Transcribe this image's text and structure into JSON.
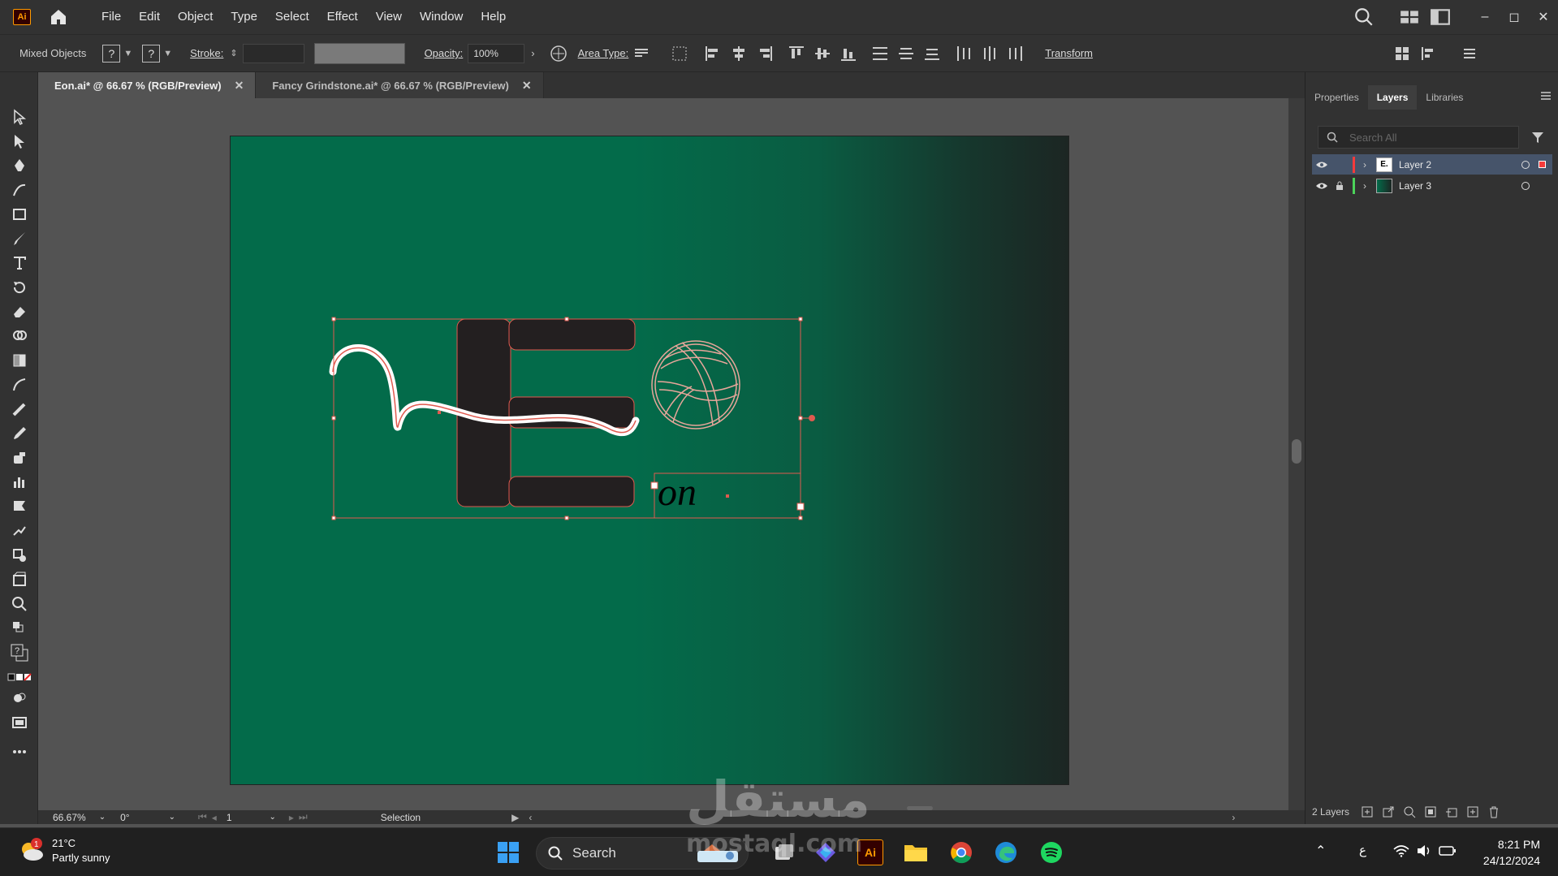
{
  "app": {
    "logo": "Ai"
  },
  "menu": [
    "File",
    "Edit",
    "Object",
    "Type",
    "Select",
    "Effect",
    "View",
    "Window",
    "Help"
  ],
  "window_controls": [
    "–",
    "◻",
    "✕"
  ],
  "controlbar": {
    "selection_label": "Mixed Objects",
    "fill_placeholder": "?",
    "stroke_placeholder": "?",
    "stroke_label": "Stroke:",
    "opacity_label": "Opacity:",
    "opacity_value": "100%",
    "area_type_label": "Area Type:",
    "transform_label": "Transform"
  },
  "tabs": [
    {
      "label": "Eon.ai* @ 66.67 % (RGB/Preview)",
      "close": "✕"
    },
    {
      "label": "Fancy Grindstone.ai* @ 66.67 % (RGB/Preview)",
      "close": "✕"
    }
  ],
  "artwork": {
    "logo_text": "on"
  },
  "panel": {
    "tabs": [
      "Properties",
      "Layers",
      "Libraries"
    ],
    "search_placeholder": "Search All",
    "layers": [
      {
        "name": "Layer 2",
        "color": "#f53b3b",
        "thumb": "E."
      },
      {
        "name": "Layer 3",
        "color": "#4bd35a",
        "thumb": ""
      }
    ],
    "footer_count": "2 Layers"
  },
  "statusbar": {
    "zoom": "66.67%",
    "rotation": "0°",
    "artboard": "1",
    "tool": "Selection"
  },
  "taskbar": {
    "weather_temp": "21°C",
    "weather_desc": "Partly sunny",
    "weather_badge": "1",
    "search_label": "Search",
    "time": "8:21 PM",
    "date": "24/12/2024",
    "lang": "ع"
  },
  "watermark": {
    "arabic": "مستقل",
    "latin": "mostaql.com"
  },
  "colors": {
    "artboard_green": "#036b4a",
    "artboard_dark": "#1c2623",
    "letter_fill": "#231f20",
    "selection": "#e05a4f"
  }
}
